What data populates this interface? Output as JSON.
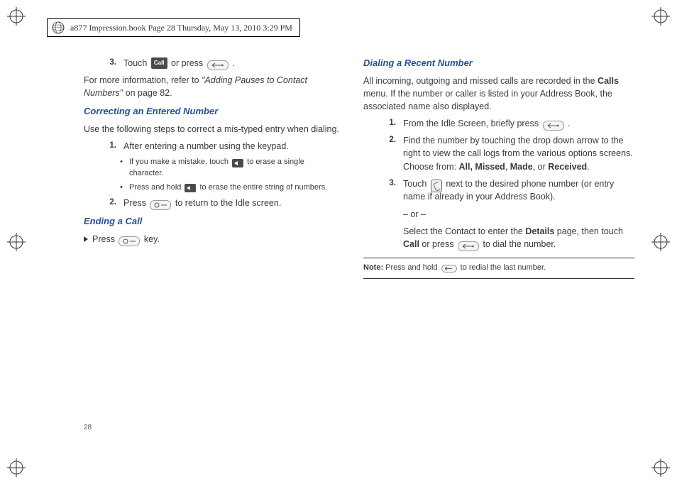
{
  "meta": {
    "text": "a877 Impression.book  Page 28  Thursday, May 13, 2010  3:29 PM"
  },
  "page_number": "28",
  "left": {
    "step3_a": "Touch ",
    "step3_b": " or press ",
    "step3_c": " .",
    "info_a": "For more information, refer to ",
    "info_ref": "\"Adding Pauses to Contact Numbers\" ",
    "info_b": " on page 82.",
    "h_correct": "Correcting an Entered Number",
    "correct_intro": "Use the following steps to correct a mis-typed entry when dialing.",
    "c_step1": "After entering a number using the keypad.",
    "c_b1_a": "If you make a mistake, touch ",
    "c_b1_b": " to erase a single character.",
    "c_b2_a": "Press and hold ",
    "c_b2_b": " to erase the entire string of numbers.",
    "c_step2_a": "Press ",
    "c_step2_b": " to return to the Idle screen.",
    "h_end": "Ending a Call",
    "end_a": "Press ",
    "end_b": " key.",
    "num1": "1.",
    "num2": "2.",
    "num3": "3."
  },
  "right": {
    "h_dial": "Dialing a Recent Number",
    "dial_intro_a": "All incoming, outgoing and missed calls are recorded in the ",
    "dial_intro_calls": "Calls",
    "dial_intro_b": " menu. If the number or caller is listed in your Address Book, the associated name also displayed.",
    "r_step1_a": "From the Idle Screen, briefly press ",
    "r_step1_b": " .",
    "r_step2_a": "Find the number by touching the drop down arrow to the right to view the call logs from the various options screens. Choose from: ",
    "r_step2_all": "All, Missed",
    "r_step2_comma1": ", ",
    "r_step2_made": "Made",
    "r_step2_comma2": ", or ",
    "r_step2_recv": "Received",
    "r_step2_period": ".",
    "r_step3_a": "Touch ",
    "r_step3_b": " next to the desired phone number (or entry name if already in your Address Book).",
    "r_or": "– or –",
    "r_step3_c": "Select the Contact to enter the ",
    "r_step3_details": "Details",
    "r_step3_d": " page, then touch ",
    "r_step3_call": "Call",
    "r_step3_e": " or press ",
    "r_step3_f": " to dial the number.",
    "note_label": "Note:",
    "note_a": " Press and hold ",
    "note_b": " to redial the last number."
  }
}
